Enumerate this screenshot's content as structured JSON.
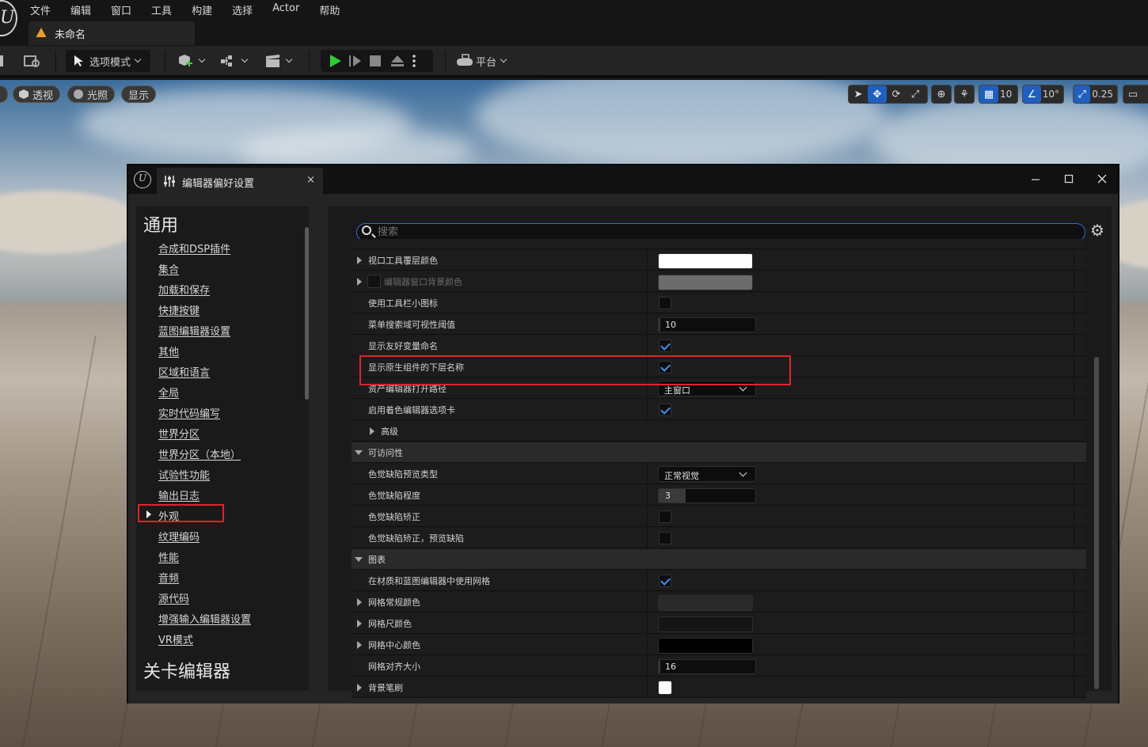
{
  "menubar": {
    "items": [
      "文件",
      "编辑",
      "窗口",
      "工具",
      "构建",
      "选择",
      "Actor",
      "帮助"
    ],
    "level_tab": "未命名"
  },
  "toolbar": {
    "mode_label": "选项模式",
    "platform_label": "平台"
  },
  "viewport": {
    "perspective_label": "透视",
    "lighting_label": "光照",
    "show_label": "显示",
    "grid_snap": "10",
    "rotation_snap": "10°",
    "scale_snap": "0.25"
  },
  "prefs": {
    "tab_title": "编辑器偏好设置",
    "close_glyph": "×",
    "search_placeholder": "搜索",
    "left": {
      "section_general": "通用",
      "items": [
        "合成和DSP插件",
        "集合",
        "加载和保存",
        "快捷按键",
        "蓝图编辑器设置",
        "其他",
        "区域和语言",
        "全局",
        "实时代码编写",
        "世界分区",
        "世界分区（本地）",
        "试验性功能",
        "输出日志",
        "外观",
        "纹理编码",
        "性能",
        "音频",
        "源代码",
        "增强输入编辑器设置",
        "VR模式"
      ],
      "section_level_editor": "关卡编辑器"
    },
    "rows": [
      {
        "name": "视口工具覆层颜色",
        "type": "color",
        "color": "#ffffff",
        "expandable": true
      },
      {
        "name": "编辑器窗口背景颜色",
        "type": "color",
        "color": "#7a7a7a",
        "expandable": true,
        "disabled": true
      },
      {
        "name": "使用工具栏小图标",
        "type": "check",
        "checked": false
      },
      {
        "name": "菜单搜索域可视性阈值",
        "type": "number",
        "value": "10",
        "fill": 0.02
      },
      {
        "name": "显示友好变量命名",
        "type": "check",
        "checked": true
      },
      {
        "name": "显示原生组件的下层名称",
        "type": "check",
        "checked": true
      },
      {
        "name": "资产编辑器打开路径",
        "type": "combo",
        "value": "主窗口"
      },
      {
        "name": "启用着色编辑器选项卡",
        "type": "check",
        "checked": true
      },
      {
        "name": "高级",
        "type": "subcat"
      },
      {
        "name": "可访问性",
        "type": "category"
      },
      {
        "name": "色觉缺陷预览类型",
        "type": "combo",
        "value": "正常视觉"
      },
      {
        "name": "色觉缺陷程度",
        "type": "number",
        "value": "3",
        "fill": 0.28
      },
      {
        "name": "色觉缺陷矫正",
        "type": "check",
        "checked": false
      },
      {
        "name": "色觉缺陷矫正，预览缺陷",
        "type": "check",
        "checked": false
      },
      {
        "name": "图表",
        "type": "category"
      },
      {
        "name": "在材质和蓝图编辑器中使用网格",
        "type": "check",
        "checked": true
      },
      {
        "name": "网格常规颜色",
        "type": "color",
        "color": "#2a2a2a",
        "expandable": true
      },
      {
        "name": "网格尺颜色",
        "type": "color",
        "color": "#151515",
        "expandable": true
      },
      {
        "name": "网格中心颜色",
        "type": "color",
        "color": "#000000",
        "expandable": true
      },
      {
        "name": "网格对齐大小",
        "type": "number",
        "value": "16",
        "fill": 0.02
      },
      {
        "name": "背景笔刷",
        "type": "color-small",
        "color": "#ffffff",
        "expandable": true
      }
    ]
  },
  "colors": {
    "accent": "#2a6fd9",
    "highlight": "#e0232b",
    "play_green": "#2fcc35"
  }
}
